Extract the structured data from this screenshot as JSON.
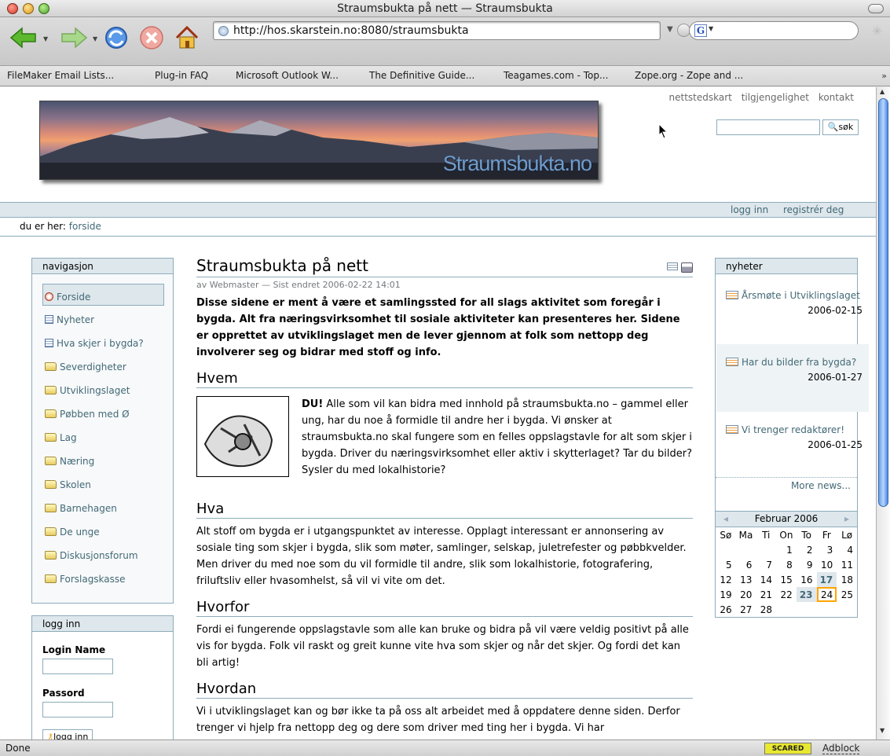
{
  "window": {
    "title": "Straumsbukta på nett — Straumsbukta"
  },
  "toolbar": {
    "url": "http://hos.skarstein.no:8080/straumsbukta"
  },
  "bookmarks": [
    "FileMaker Email Lists...",
    "Plug-in FAQ",
    "Microsoft Outlook W...",
    "The Definitive Guide...",
    "Teagames.com - Top...",
    "Zope.org - Zope and ..."
  ],
  "bookmarks_more": "»",
  "site": {
    "top_links": [
      "nettstedskart",
      "tilgjengelighet",
      "kontakt"
    ],
    "banner_text": "Straumsbukta.no",
    "search_button": "søk",
    "personal": {
      "login": "logg inn",
      "register": "registrér deg"
    },
    "crumbs": {
      "label": "du er her:",
      "home": "forside"
    }
  },
  "nav": {
    "title": "navigasjon",
    "items": [
      "Forside",
      "Nyheter",
      "Hva skjer i bygda?",
      "Severdigheter",
      "Utviklingslaget",
      "Pøbben med Ø",
      "Lag",
      "Næring",
      "Skolen",
      "Barnehagen",
      "De unge",
      "Diskusjonsforum",
      "Forslagskasse"
    ]
  },
  "login": {
    "title": "logg inn",
    "name_label": "Login Name",
    "pass_label": "Passord",
    "button": "logg inn"
  },
  "main": {
    "title": "Straumsbukta på nett",
    "byline": "av Webmaster — Sist endret 2006-02-22 14:01",
    "lead": "Disse sidene er ment å være et samlingssted for all slags aktivitet som foregår i bygda. Alt fra næringsvirksomhet til sosiale aktiviteter kan presenteres her. Sidene er opprettet av utviklingslaget men de lever gjennom at folk som nettopp deg involverer seg og bidrar med stoff og info.",
    "h_hvem": "Hvem",
    "hvem_bold": "DU!",
    "hvem_text": " Alle som vil kan bidra med innhold på straumsbukta.no – gammel eller ung, har du noe å formidle til andre her i bygda. Vi ønsker at straumsbukta.no skal fungere som en felles oppslagstavle for alt som skjer i bygda. Driver du næringsvirksomhet eller aktiv i skytterlaget? Tar du bilder? Sysler du med lokalhistorie?",
    "h_hva": "Hva",
    "hva_text": "Alt stoff om bygda er i utgangspunktet av interesse. Opplagt interessant er annonsering av sosiale ting som skjer i bygda, slik som møter, samlinger, selskap, juletrefester og pøbbkvelder. Men driver du med noe som du vil formidle til andre, slik som lokalhistorie, fotografering, friluftsliv eller hvasomhelst, så vil vi vite om det.",
    "h_hvorfor": "Hvorfor",
    "hvorfor_text": "Fordi ei fungerende oppslagstavle som alle kan bruke og bidra på vil være veldig positivt på alle vis for bygda. Folk vil raskt og greit kunne vite hva som skjer og når det skjer. Og fordi det kan bli artig!",
    "h_hvordan": "Hvordan",
    "hvordan_text": "Vi i utviklingslaget kan og bør ikke ta på oss alt arbeidet med å oppdatere denne siden. Derfor trenger vi hjelp fra nettopp deg og dere som driver med ting her i bygda. Vi har"
  },
  "news": {
    "title": "nyheter",
    "items": [
      {
        "title": "Årsmøte i Utviklingslaget",
        "date": "2006-02-15"
      },
      {
        "title": "Har du bilder fra bygda?",
        "date": "2006-01-27"
      },
      {
        "title": "Vi trenger redaktører!",
        "date": "2006-01-25"
      }
    ],
    "more": "More news..."
  },
  "calendar": {
    "month": "Februar 2006",
    "weekdays": [
      "Sø",
      "Ma",
      "Ti",
      "On",
      "To",
      "Fr",
      "Lø"
    ],
    "weeks": [
      [
        "",
        "",
        "",
        "1",
        "2",
        "3",
        "4"
      ],
      [
        "5",
        "6",
        "7",
        "8",
        "9",
        "10",
        "11"
      ],
      [
        "12",
        "13",
        "14",
        "15",
        "16",
        "17",
        "18"
      ],
      [
        "19",
        "20",
        "21",
        "22",
        "23",
        "24",
        "25"
      ],
      [
        "26",
        "27",
        "28",
        "",
        "",
        "",
        ""
      ]
    ],
    "event_days": [
      "17",
      "23"
    ],
    "today": "24"
  },
  "status": {
    "text": "Done",
    "badge": "SCARED",
    "adblock": "Adblock"
  }
}
